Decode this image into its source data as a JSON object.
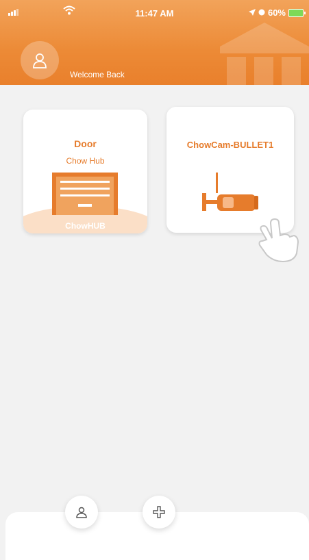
{
  "status_bar": {
    "time": "11:47 AM",
    "battery": "60%"
  },
  "header": {
    "welcome": "Welcome Back"
  },
  "devices": [
    {
      "title": "Door",
      "subtitle": "Chow Hub",
      "badge": "ChowHUB"
    },
    {
      "title": "ChowCam-BULLET1"
    }
  ],
  "colors": {
    "accent": "#ec8a36",
    "background": "#f2f2f2"
  },
  "icons": {
    "avatar": "user-icon",
    "garage": "garage-door-icon",
    "camera": "bullet-camera-icon",
    "hand": "tap-hand-icon",
    "user_tab": "user-icon",
    "add_tab": "plus-icon"
  }
}
